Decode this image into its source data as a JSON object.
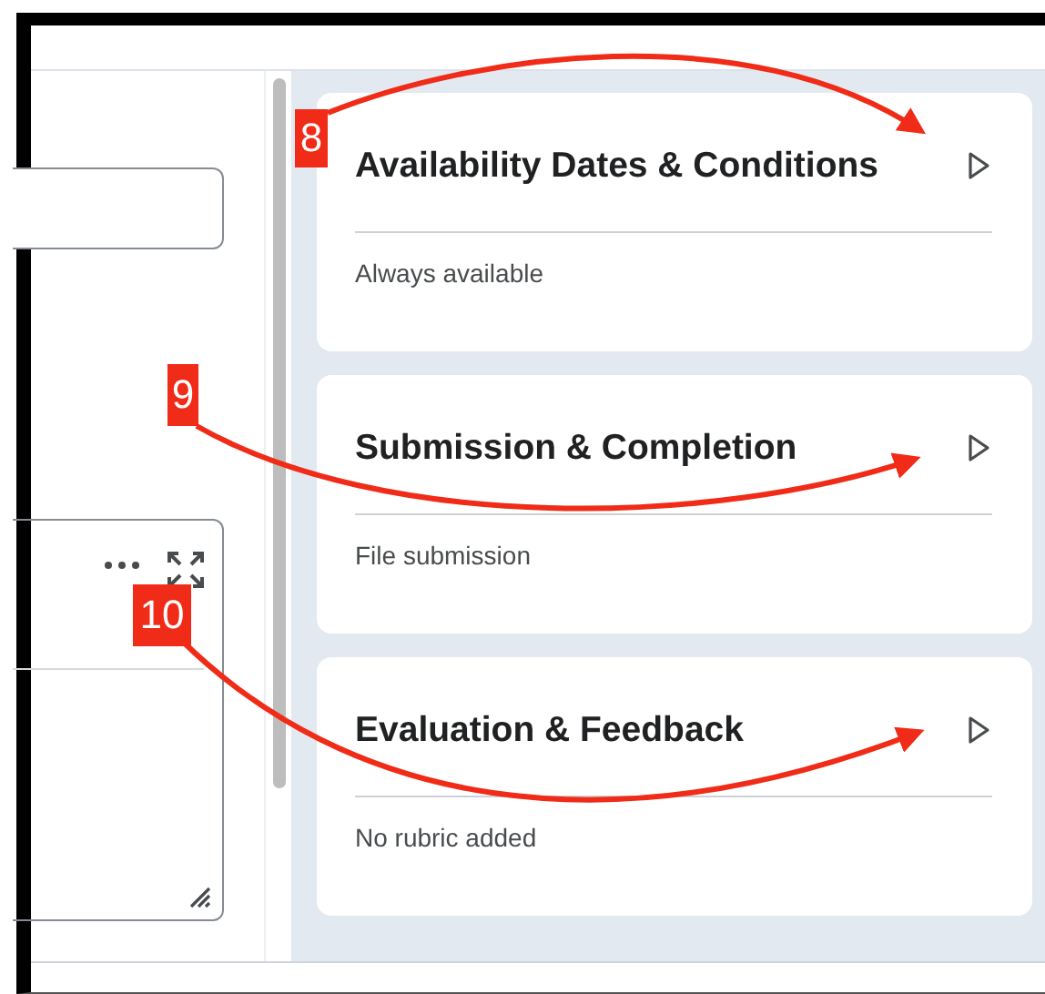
{
  "cards": [
    {
      "title": "Availability Dates & Conditions",
      "summary": "Always available",
      "expanded": false
    },
    {
      "title": "Submission & Completion",
      "summary": "File submission",
      "expanded": false
    },
    {
      "title": "Evaluation & Feedback",
      "summary": "No rubric added",
      "expanded": false
    }
  ],
  "annotations": [
    {
      "label": "8"
    },
    {
      "label": "9"
    },
    {
      "label": "10"
    }
  ]
}
